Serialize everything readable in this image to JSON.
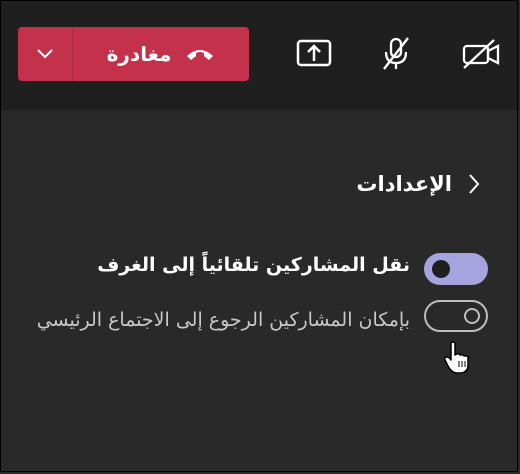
{
  "toolbar": {
    "leave_label": "مغادرة",
    "icons": [
      "chevron-down-icon",
      "hang-up-icon",
      "share-screen-icon",
      "mic-off-icon",
      "camera-off-icon"
    ]
  },
  "settings": {
    "title": "الإعدادات",
    "move_participants_label": "نقل المشاركين تلقائياً إلى الغرف",
    "move_participants_on": true,
    "return_to_main_label": "بإمكان المشاركين الرجوع إلى الاجتماع الرئيسي",
    "return_to_main_on": false
  },
  "colors": {
    "leave_red": "#c4314b",
    "toggle_on": "#a5a4de",
    "topbar_bg": "#1f1f1f",
    "panel_bg": "#292929"
  }
}
